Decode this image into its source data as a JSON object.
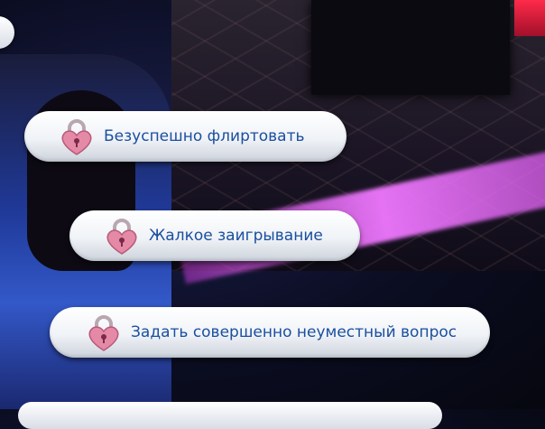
{
  "menu": {
    "items": [
      {
        "label": "Безуспешно флиртовать",
        "icon": "heart-lock-icon"
      },
      {
        "label": "Жалкое заигрывание",
        "icon": "heart-lock-icon"
      },
      {
        "label": "Задать совершенно неуместный вопрос",
        "icon": "heart-lock-icon"
      }
    ]
  },
  "colors": {
    "label_text": "#1a4fa0",
    "lock_heart": "#e58aa6",
    "beam": "#e07aff"
  }
}
